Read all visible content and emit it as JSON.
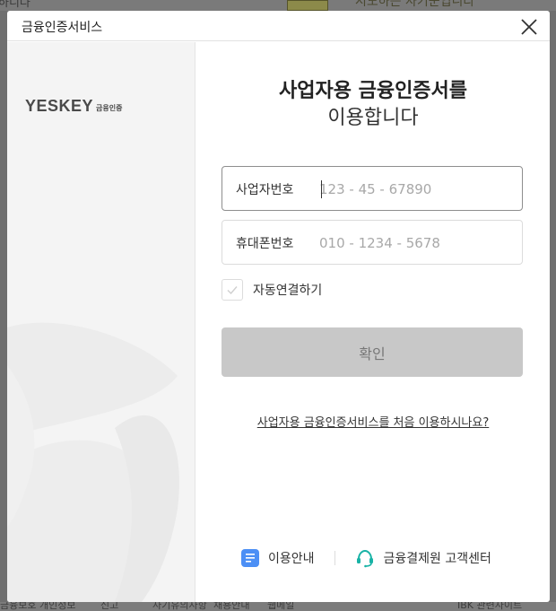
{
  "background": {
    "top_left_text": "하니다",
    "top_right_text": "시도하는 사기꾼입니다",
    "bottom_links": [
      "금융보호",
      "개인정보",
      "신고",
      "사기유의사항",
      "채용안내",
      "웹메일",
      "IBK 관련사이트"
    ]
  },
  "modal": {
    "title": "금융인증서비스",
    "logo": {
      "main": "YESKEY",
      "sub": "금융인증"
    },
    "heading": {
      "line1": "사업자용 금융인증서를",
      "line2": "이용합니다"
    },
    "business_number": {
      "label": "사업자번호",
      "placeholder": "123 - 45 - 67890",
      "value": ""
    },
    "phone_number": {
      "label": "휴대폰번호",
      "placeholder": "010 - 1234 - 5678",
      "value": ""
    },
    "auto_connect": {
      "label": "자동연결하기",
      "checked": false
    },
    "confirm_label": "확인",
    "first_time_link": "사업자용 금융인증서비스를 처음 이용하시나요?",
    "footer": {
      "guide_label": "이용안내",
      "support_label": "금융결제원 고객센터"
    }
  },
  "colors": {
    "confirm_bg": "#c8c8c8",
    "guide_icon": "#4c8ff5",
    "support_icon": "#19b3a6",
    "left_panel_bg": "#f4f4f4"
  }
}
